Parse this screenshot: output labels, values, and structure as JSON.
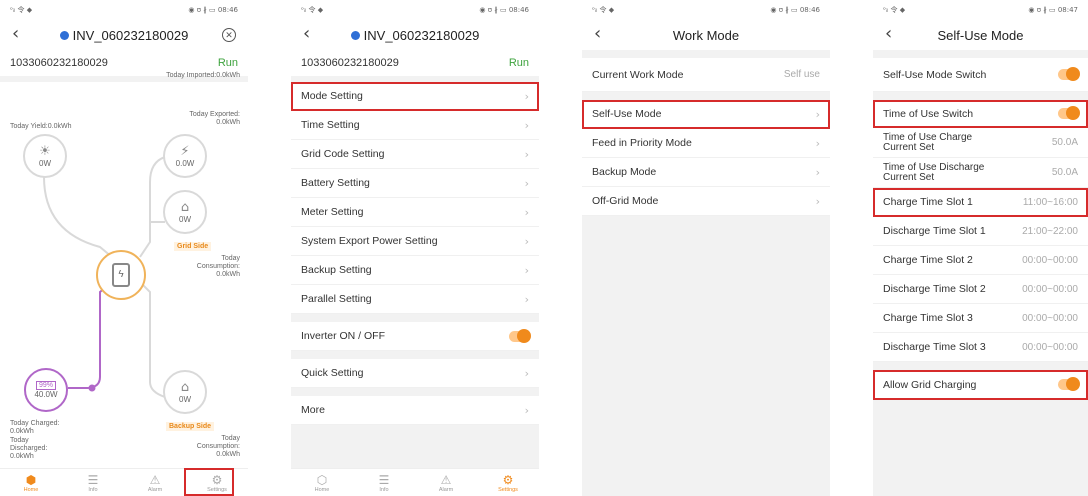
{
  "status": {
    "left": "ᵒᵢₗ 令 ◆",
    "right_a": "◉ ʊ ∦ ▭ 08:46",
    "right_b": "◉ ʊ ∦ ▭ 08:46",
    "right_c": "◉ ʊ ∦ ▭ 08:46",
    "right_d": "◉ ʊ ∦ ▭ 08:47"
  },
  "screen1": {
    "title": "INV_060232180029",
    "serial": "1033060232180029",
    "state": "Run",
    "today_yield": "Today Yield:0.0kWh",
    "today_imported": "Today Imported:0.0kWh",
    "today_exported": "Today Exported:",
    "today_exported_val": "0.0kWh",
    "pv_power": "0W",
    "grid_power": "0.0W",
    "grid_load_power": "0W",
    "grid_side": "Grid Side",
    "today_consumption": "Today",
    "consumption_label": "Consumption:",
    "consumption_val": "0.0kWh",
    "battery_soc": "99%",
    "battery_power": "40.0W",
    "today_charged": "Today Charged:",
    "today_charged_val": "0.0kWh",
    "today_discharged": "Today",
    "discharged_label": "Discharged:",
    "discharged_val": "0.0kWh",
    "backup_power": "0W",
    "backup_side": "Backup Side",
    "backup_today": "Today",
    "backup_consumption": "Consumption:",
    "backup_consumption_val": "0.0kWh",
    "nav": {
      "home": "Home",
      "info": "Info",
      "alarm": "Alarm",
      "settings": "Settings"
    }
  },
  "screen2": {
    "title": "INV_060232180029",
    "serial": "1033060232180029",
    "state": "Run",
    "items": [
      "Mode Setting",
      "Time Setting",
      "Grid Code Setting",
      "Battery Setting",
      "Meter Setting",
      "System Export Power Setting",
      "Backup Setting",
      "Parallel Setting"
    ],
    "inverter_onoff": "Inverter ON / OFF",
    "quick_setting": "Quick Setting",
    "more": "More",
    "nav": {
      "home": "Home",
      "info": "Info",
      "alarm": "Alarm",
      "settings": "Settings"
    }
  },
  "screen3": {
    "title": "Work Mode",
    "current_label": "Current Work Mode",
    "current_value": "Self use",
    "modes": [
      "Self-Use Mode",
      "Feed in Priority Mode",
      "Backup Mode",
      "Off-Grid Mode"
    ]
  },
  "screen4": {
    "title": "Self-Use Mode",
    "switch_label": "Self-Use Mode Switch",
    "tou_switch": "Time of Use Switch",
    "tou_charge_current": "Time of Use Charge Current Set",
    "tou_charge_current_val": "50.0A",
    "tou_discharge_current": "Time of Use Discharge Current Set",
    "tou_discharge_current_val": "50.0A",
    "slots": [
      {
        "label": "Charge Time Slot 1",
        "value": "11:00~16:00"
      },
      {
        "label": "Discharge Time Slot 1",
        "value": "21:00~22:00"
      },
      {
        "label": "Charge Time Slot 2",
        "value": "00:00~00:00"
      },
      {
        "label": "Discharge Time Slot 2",
        "value": "00:00~00:00"
      },
      {
        "label": "Charge Time Slot 3",
        "value": "00:00~00:00"
      },
      {
        "label": "Discharge Time Slot 3",
        "value": "00:00~00:00"
      }
    ],
    "allow_grid": "Allow Grid Charging"
  }
}
